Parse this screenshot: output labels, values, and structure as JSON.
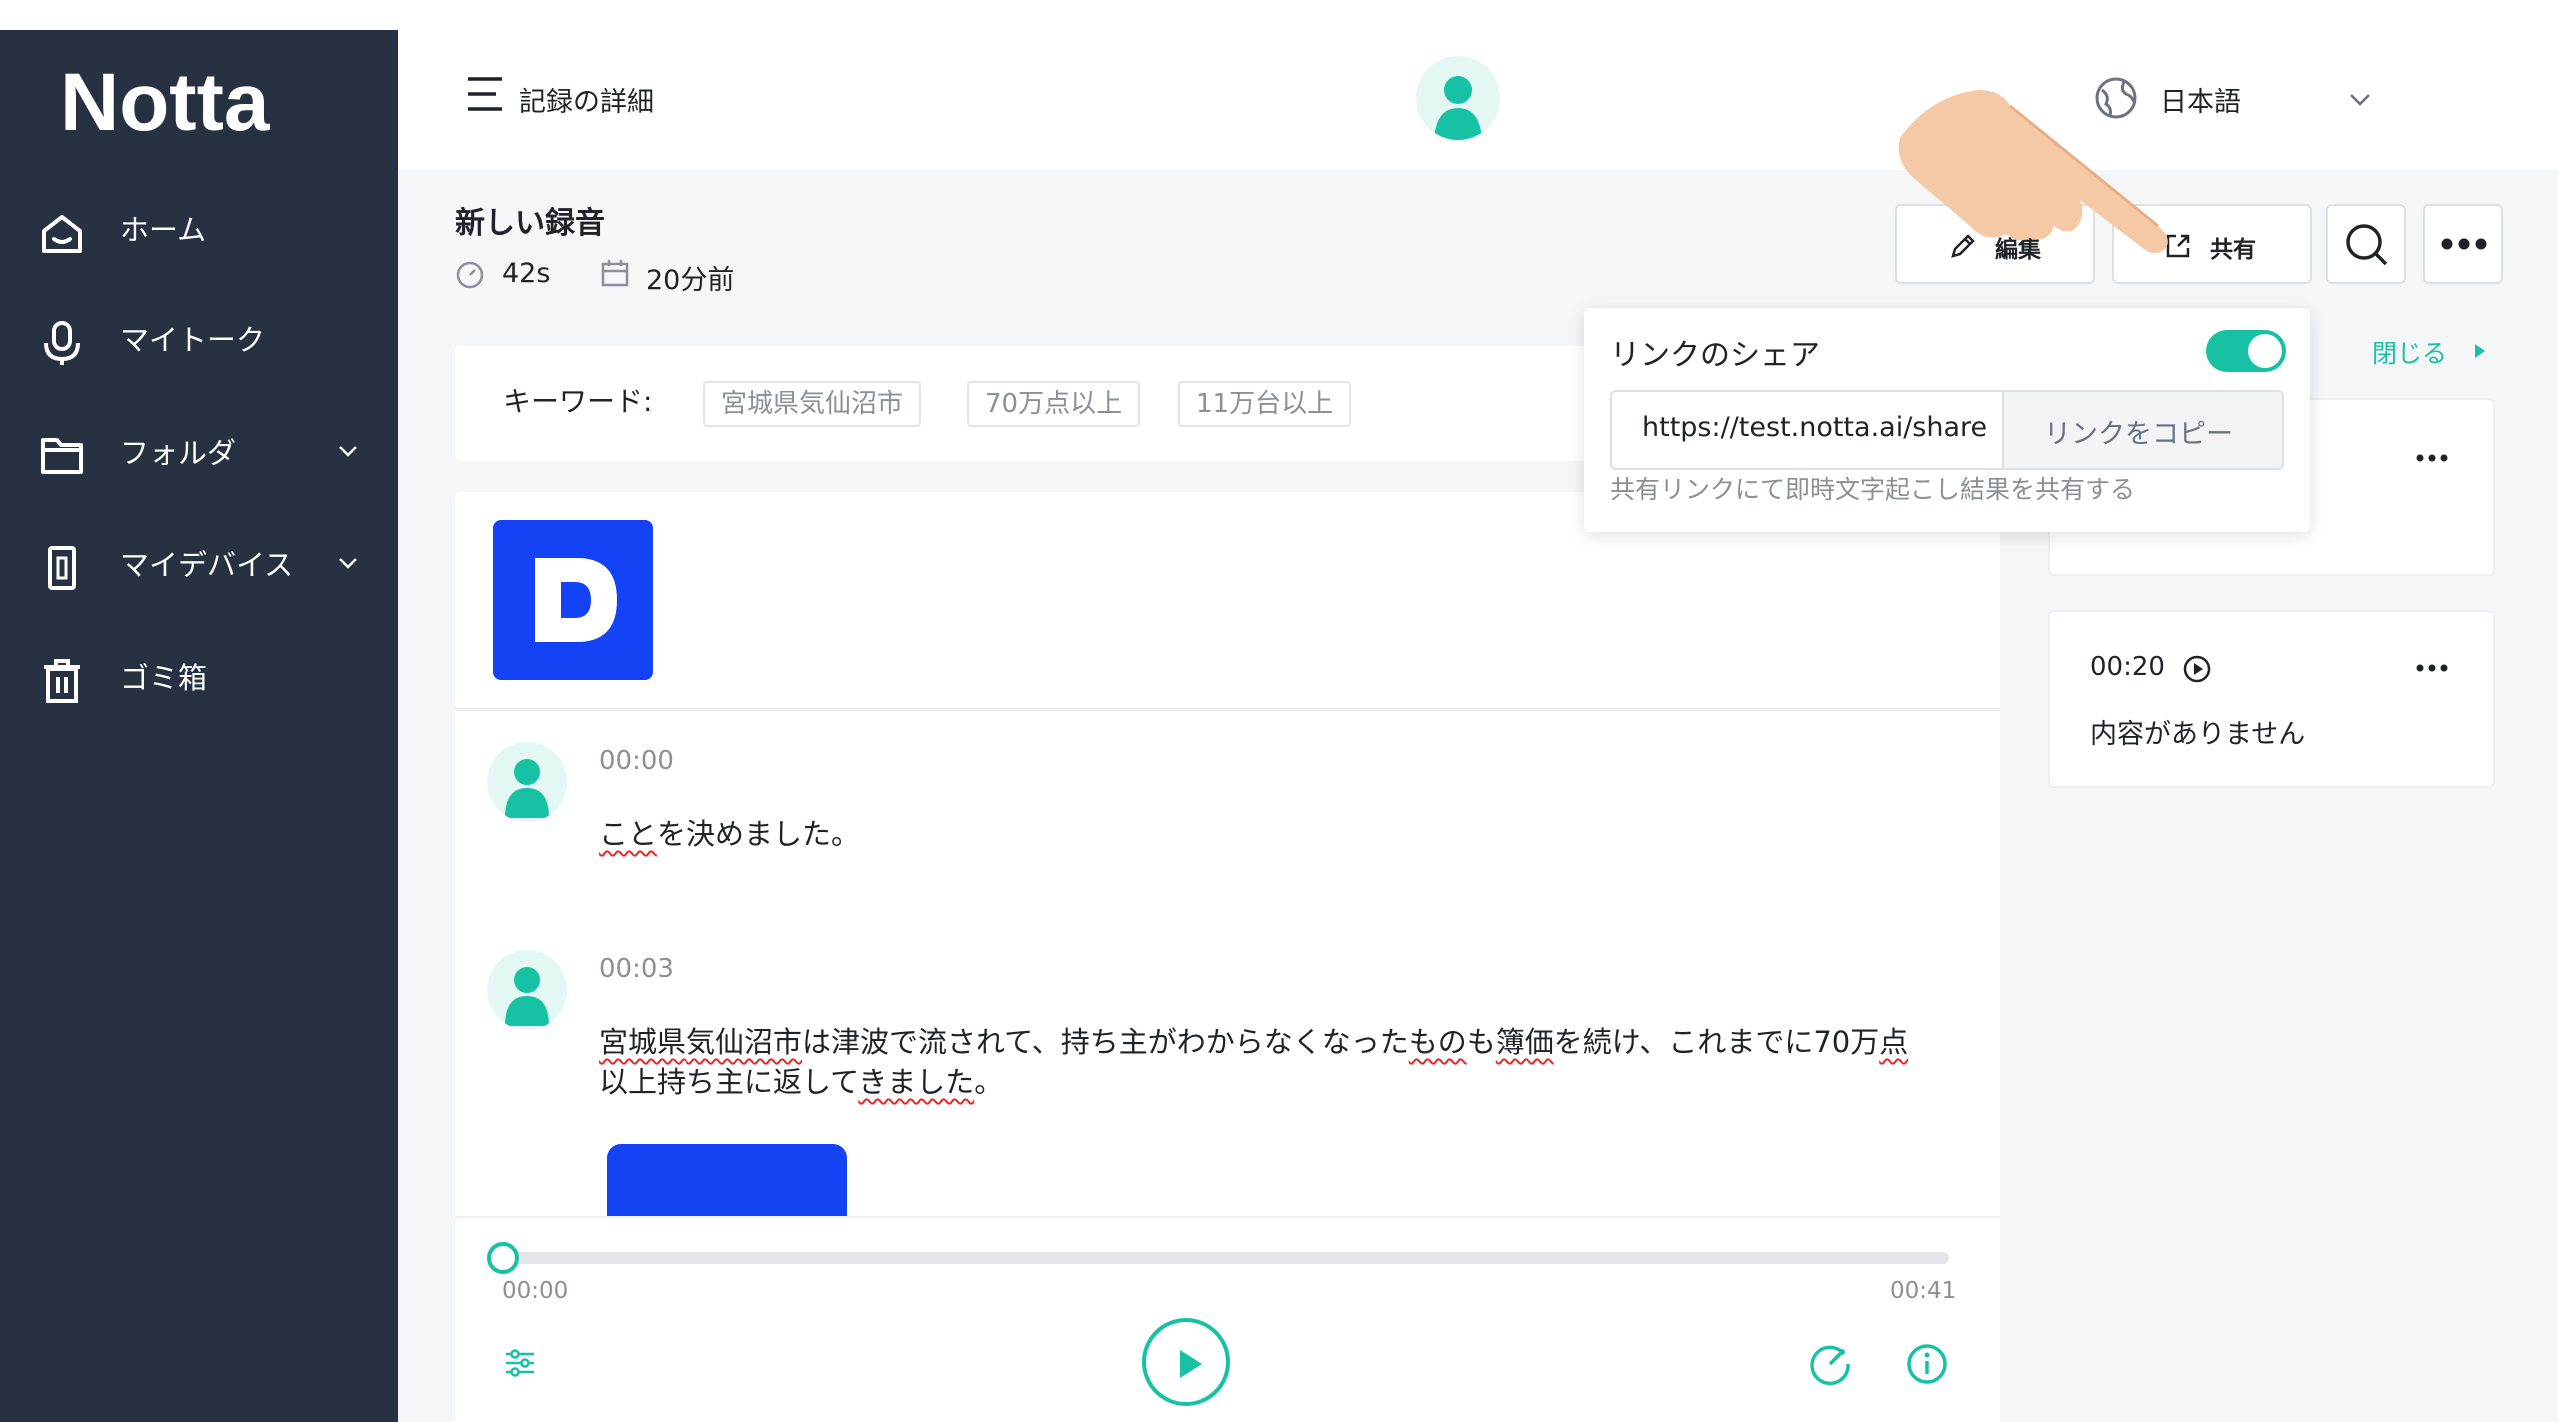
{
  "app": {
    "logo": "Notta"
  },
  "sidebar": {
    "items": [
      {
        "label": "ホーム",
        "icon": "home-icon"
      },
      {
        "label": "マイトーク",
        "icon": "microphone-icon"
      },
      {
        "label": "フォルダ",
        "icon": "folder-icon"
      },
      {
        "label": "マイデバイス",
        "icon": "device-icon"
      },
      {
        "label": "ゴミ箱",
        "icon": "trash-icon"
      }
    ]
  },
  "header": {
    "title": "記録の詳細",
    "language": "日本語"
  },
  "recording": {
    "title": "新しい録音",
    "duration": "42s",
    "created": "20分前"
  },
  "toolbar": {
    "edit_label": "編集",
    "share_label": "共有"
  },
  "keywords": {
    "label": "キーワード:",
    "tags": [
      "宮城県気仙沼市",
      "70万点以上",
      "11万台以上"
    ]
  },
  "share_popup": {
    "title": "リンクのシェア",
    "toggle_on": true,
    "url": "https://test.notta.ai/share",
    "copy_label": "リンクをコピー",
    "hint": "共有リンクにて即時文字起こし結果を共有する"
  },
  "right_panel": {
    "close_label": "閉じる",
    "cards": [
      {
        "time": "",
        "text": ""
      },
      {
        "time": "00:20",
        "text": "内容がありません"
      }
    ]
  },
  "transcript": [
    {
      "time": "00:00",
      "segments": [
        {
          "t": "こと",
          "w": true
        },
        {
          "t": "を決めました。",
          "w": false
        }
      ]
    },
    {
      "time": "00:03",
      "segments": [
        {
          "t": "宮城県",
          "w": true
        },
        {
          "t": "気仙沼市",
          "w": true
        },
        {
          "t": "は津波で流されて、持ち主がわからなくなった",
          "w": false
        },
        {
          "t": "もの",
          "w": true
        },
        {
          "t": "も",
          "w": false
        },
        {
          "t": "簿価",
          "w": true
        },
        {
          "t": "を続け、これまでに70万",
          "w": false
        },
        {
          "t": "点",
          "w": true
        },
        {
          "t": "以上持ち主に返して",
          "w": false
        },
        {
          "t": "きました",
          "w": true
        },
        {
          "t": "。",
          "w": false
        }
      ]
    }
  ],
  "player": {
    "current": "00:00",
    "total": "00:41",
    "progress": 0
  },
  "colors": {
    "accent": "#17c2a4",
    "sidebar": "#273142",
    "brand_blue": "#1442f5",
    "link": "#17c2a4"
  }
}
